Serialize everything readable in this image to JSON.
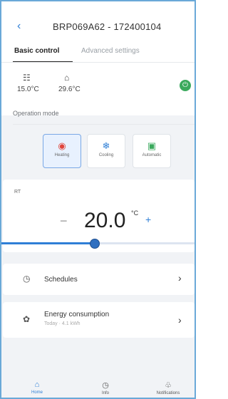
{
  "header": {
    "title": "BRP069A62 - 172400104",
    "back_icon": "back-chevron-icon"
  },
  "tabs": [
    {
      "label": "Basic control",
      "active": true
    },
    {
      "label": "Advanced settings",
      "active": false
    }
  ],
  "temperatures": {
    "indoor": {
      "value": "15.0°C",
      "icon": "radiator-icon"
    },
    "outdoor": {
      "value": "29.6°C",
      "icon": "house-icon"
    }
  },
  "power": {
    "state": "on",
    "icon": "power-icon",
    "color": "#3aa95c"
  },
  "operation_mode": {
    "label": "Operation mode",
    "modes": [
      {
        "label": "Heating",
        "icon": "heating-icon",
        "active": true
      },
      {
        "label": "Cooling",
        "icon": "snowflake-icon",
        "active": false
      },
      {
        "label": "Automatic",
        "icon": "auto-mode-icon",
        "active": false
      }
    ]
  },
  "setpoint": {
    "label": "RT",
    "value": "20.0",
    "unit": "°C",
    "minus": "−",
    "plus": "+",
    "slider_fraction": 0.48
  },
  "rows": [
    {
      "label": "Schedules",
      "icon": "clock-icon"
    },
    {
      "label": "Energy consumption",
      "sublabel": "Today · 4.1 kWh",
      "icon": "leaf-icon"
    }
  ],
  "bottom_nav": [
    {
      "label": "Home",
      "icon": "home-icon",
      "active": true
    },
    {
      "label": "Info",
      "icon": "info-clock-icon",
      "active": false
    },
    {
      "label": "Notifications",
      "icon": "bell-icon",
      "active": false
    }
  ],
  "colors": {
    "accent": "#2f7fd6",
    "power_on": "#3aa95c",
    "frame_border": "#6aa9d8"
  }
}
